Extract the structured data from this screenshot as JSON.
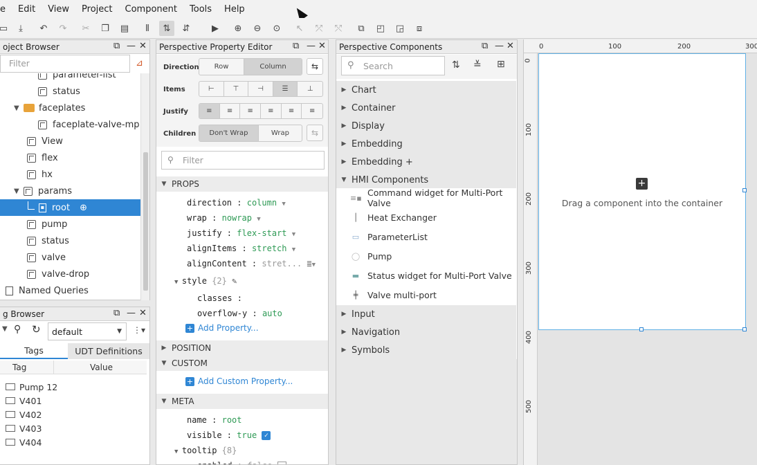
{
  "menu": [
    "e",
    "Edit",
    "View",
    "Project",
    "Component",
    "Tools",
    "Help"
  ],
  "project_browser": {
    "title": "oject Browser",
    "filter_placeholder": "Filter",
    "items": [
      {
        "label": "parameter-list",
        "icon": "cube-icon"
      },
      {
        "label": "status",
        "icon": "cube-icon"
      },
      {
        "label": "faceplates",
        "icon": "folder-icon"
      },
      {
        "label": "faceplate-valve-mp",
        "icon": "cube-icon"
      },
      {
        "label": "View",
        "icon": "cube-icon"
      },
      {
        "label": "flex",
        "icon": "cube-icon"
      },
      {
        "label": "hx",
        "icon": "cube-icon"
      },
      {
        "label": "params",
        "icon": "cube-check-icon"
      },
      {
        "label": "root",
        "icon": "component-icon"
      },
      {
        "label": "pump",
        "icon": "cube-icon"
      },
      {
        "label": "status",
        "icon": "cube-icon"
      },
      {
        "label": "valve",
        "icon": "cube-icon"
      },
      {
        "label": "valve-drop",
        "icon": "cube-icon"
      },
      {
        "label": "Named Queries",
        "icon": "queries-icon"
      }
    ]
  },
  "tag_browser": {
    "title": "g Browser",
    "provider": "default",
    "tabs": [
      "Tags",
      "UDT Definitions"
    ],
    "columns": [
      "Tag",
      "Value"
    ],
    "tags": [
      "Pump 12",
      "V401",
      "V402",
      "V403",
      "V404"
    ]
  },
  "property_editor": {
    "title": "Perspective Property Editor",
    "direction_label": "Direction",
    "direction_options": [
      "Row",
      "Column"
    ],
    "items_label": "Items",
    "justify_label": "Justify",
    "children_label": "Children",
    "children_options": [
      "Don't Wrap",
      "Wrap"
    ],
    "filter_placeholder": "Filter",
    "props_header": "PROPS",
    "props": {
      "direction": "column",
      "wrap": "nowrap",
      "justify": "flex-start",
      "alignItems": "stretch",
      "alignContent": "stret...",
      "style_count": "{2}",
      "classes": "",
      "overflow_y": "auto"
    },
    "add_property": "Add Property...",
    "position_header": "POSITION",
    "custom_header": "CUSTOM",
    "add_custom_property": "Add Custom Property...",
    "meta_header": "META",
    "meta": {
      "name": "root",
      "visible": "true",
      "tooltip_count": "{8}",
      "enabled": "false"
    },
    "prop_labels": {
      "direction": "direction",
      "wrap": "wrap",
      "justify": "justify",
      "alignItems": "alignItems",
      "alignContent": "alignContent",
      "style": "style",
      "classes": "classes",
      "overflow_y": "overflow-y",
      "name": "name",
      "visible": "visible",
      "tooltip": "tooltip",
      "enabled": "enabled"
    }
  },
  "components": {
    "title": "Perspective Components",
    "search_placeholder": "Search",
    "categories_top": [
      "Chart",
      "Container",
      "Display",
      "Embedding",
      "Embedding +",
      "HMI Components"
    ],
    "hmi_items": [
      "Command widget for Multi-Port Valve",
      "Heat Exchanger",
      "ParameterList",
      "Pump",
      "Status widget for Multi-Port Valve",
      "Valve multi-port"
    ],
    "categories_bottom": [
      "Input",
      "Navigation",
      "Symbols"
    ]
  },
  "canvas": {
    "placeholder": "Drag a component into the container",
    "ruler_h": [
      "0",
      "100",
      "200",
      "300"
    ],
    "ruler_v": [
      "0",
      "100",
      "200",
      "300",
      "400",
      "500"
    ]
  },
  "colors": {
    "accent": "#2f86d4",
    "value_green": "#2e9a55"
  }
}
